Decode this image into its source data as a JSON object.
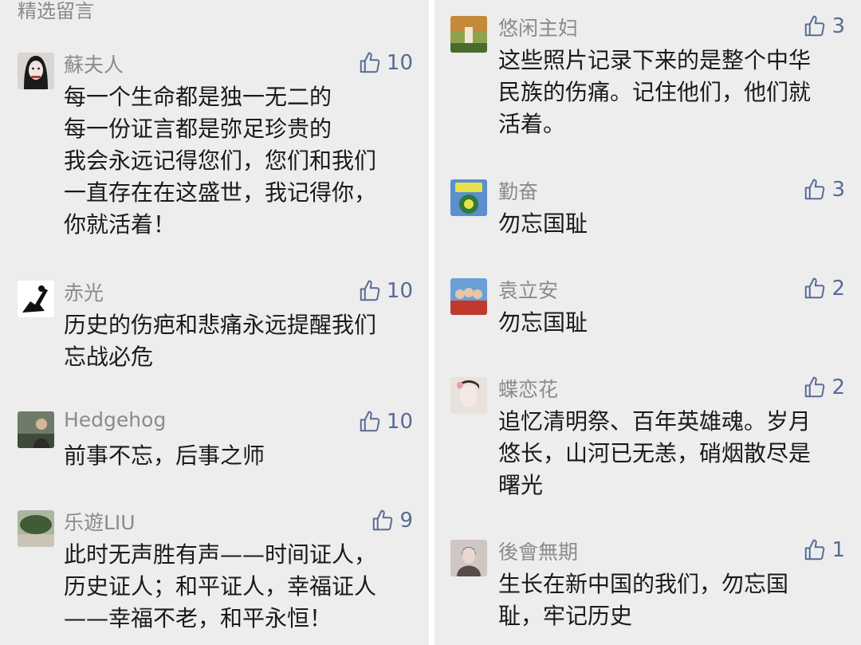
{
  "header": {
    "title": "精选留言"
  },
  "left_comments": [
    {
      "name": "蘇夫人",
      "likes": "10",
      "text": "每一个生命都是独一无二的\n每一份证言都是弥足珍贵的\n我会永远记得您们，您们和我们\n一直存在在这盛世，我记得你，\n你就活着！"
    },
    {
      "name": "赤光",
      "likes": "10",
      "text": "历史的伤疤和悲痛永远提醒我们\n忘战必危"
    },
    {
      "name": "Hedgehog",
      "likes": "10",
      "text": "前事不忘，后事之师"
    },
    {
      "name": "乐遊LIU",
      "likes": "9",
      "text": "此时无声胜有声——时间证人，\n历史证人；和平证人，幸福证人\n——幸福不老，和平永恒！"
    }
  ],
  "right_comments": [
    {
      "name": "悠闲主妇",
      "likes": "3",
      "text": "这些照片记录下来的是整个中华\n民族的伤痛。记住他们，他们就\n活着。"
    },
    {
      "name": "勤奋",
      "likes": "3",
      "text": "勿忘国耻"
    },
    {
      "name": "袁立安",
      "likes": "2",
      "text": "勿忘国耻"
    },
    {
      "name": "蝶恋花",
      "likes": "2",
      "text": "追忆清明祭、百年英雄魂。岁月\n悠长，山河已无恙，硝烟散尽是\n曙光"
    },
    {
      "name": "後會無期",
      "likes": "1",
      "text": "生长在新中国的我们，勿忘国\n耻，牢记历史"
    }
  ],
  "colors": {
    "background": "#ededed",
    "name": "#8b8b8b",
    "like": "#576b95",
    "text": "#1a1a1a"
  },
  "icons": {
    "like": "thumbs-up-icon"
  }
}
